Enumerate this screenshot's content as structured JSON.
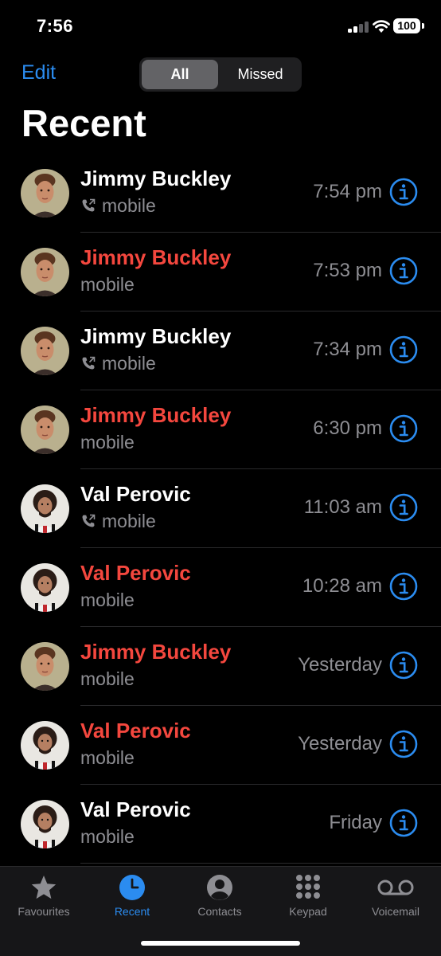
{
  "status_bar": {
    "time": "7:56",
    "battery": "100"
  },
  "header": {
    "edit_label": "Edit",
    "title": "Recent"
  },
  "segmented": {
    "all": "All",
    "missed": "Missed"
  },
  "colors": {
    "accent": "#2b8cf0",
    "missed": "#f4473e",
    "secondary": "#8e8e93"
  },
  "calls": [
    {
      "name": "Jimmy Buckley",
      "type": "mobile",
      "time": "7:54 pm",
      "missed": false,
      "outgoing": true,
      "avatar": "jimmy"
    },
    {
      "name": "Jimmy Buckley",
      "type": "mobile",
      "time": "7:53 pm",
      "missed": true,
      "outgoing": false,
      "avatar": "jimmy"
    },
    {
      "name": "Jimmy Buckley",
      "type": "mobile",
      "time": "7:34 pm",
      "missed": false,
      "outgoing": true,
      "avatar": "jimmy"
    },
    {
      "name": "Jimmy Buckley",
      "type": "mobile",
      "time": "6:30 pm",
      "missed": true,
      "outgoing": false,
      "avatar": "jimmy"
    },
    {
      "name": "Val Perovic",
      "type": "mobile",
      "time": "11:03 am",
      "missed": false,
      "outgoing": true,
      "avatar": "val"
    },
    {
      "name": "Val Perovic",
      "type": "mobile",
      "time": "10:28 am",
      "missed": true,
      "outgoing": false,
      "avatar": "val"
    },
    {
      "name": "Jimmy Buckley",
      "type": "mobile",
      "time": "Yesterday",
      "missed": true,
      "outgoing": false,
      "avatar": "jimmy"
    },
    {
      "name": "Val Perovic",
      "type": "mobile",
      "time": "Yesterday",
      "missed": true,
      "outgoing": false,
      "avatar": "val"
    },
    {
      "name": "Val Perovic",
      "type": "mobile",
      "time": "Friday",
      "missed": false,
      "outgoing": false,
      "avatar": "val"
    }
  ],
  "tabs": [
    {
      "label": "Favourites",
      "icon": "star-icon",
      "active": false
    },
    {
      "label": "Recent",
      "icon": "clock-icon",
      "active": true
    },
    {
      "label": "Contacts",
      "icon": "person-circle-icon",
      "active": false
    },
    {
      "label": "Keypad",
      "icon": "keypad-icon",
      "active": false
    },
    {
      "label": "Voicemail",
      "icon": "voicemail-icon",
      "active": false
    }
  ]
}
